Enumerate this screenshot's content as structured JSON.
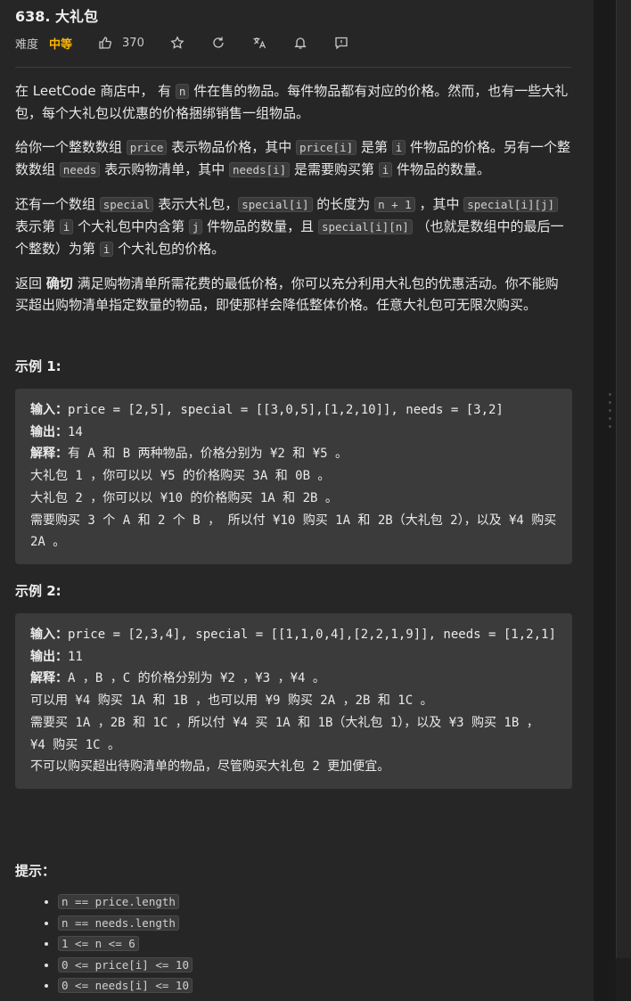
{
  "problem": {
    "title": "638. 大礼包",
    "difficulty_label": "难度",
    "difficulty": "中等",
    "likes": "370"
  },
  "description": {
    "p1": {
      "a": "在 LeetCode 商店中， 有 ",
      "c1": "n",
      "b": " 件在售的物品。每件物品都有对应的价格。然而，也有一些大礼包，每个大礼包以优惠的价格捆绑销售一组物品。"
    },
    "p2": {
      "a": "给你一个整数数组 ",
      "c1": "price",
      "b": " 表示物品价格，其中 ",
      "c2": "price[i]",
      "c": " 是第 ",
      "c3": "i",
      "d": " 件物品的价格。另有一个整数数组 ",
      "c4": "needs",
      "e": " 表示购物清单，其中 ",
      "c5": "needs[i]",
      "f": " 是需要购买第 ",
      "c6": "i",
      "g": " 件物品的数量。"
    },
    "p3": {
      "a": "还有一个数组 ",
      "c1": "special",
      "b": " 表示大礼包，",
      "c2": "special[i]",
      "c": " 的长度为 ",
      "c3": "n + 1",
      "d": " ，其中 ",
      "c4": "special[i][j]",
      "e": " 表示第 ",
      "c5": "i",
      "f": " 个大礼包中内含第 ",
      "c6": "j",
      "g": " 件物品的数量，且 ",
      "c7": "special[i][n]",
      "h": " （也就是数组中的最后一个整数）为第 ",
      "c8": "i",
      "i": " 个大礼包的价格。"
    },
    "p4": {
      "a": "返回 ",
      "bold": "确切",
      "b": " 满足购物清单所需花费的最低价格，你可以充分利用大礼包的优惠活动。你不能购买超出购物清单指定数量的物品，即使那样会降低整体价格。任意大礼包可无限次购买。"
    }
  },
  "examples": [
    {
      "heading": "示例 1:",
      "input_label": "输入：",
      "input": "price = [2,5], special = [[3,0,5],[1,2,10]], needs = [3,2]",
      "output_label": "输出：",
      "output": "14",
      "explain_label": "解释：",
      "explain_lines": [
        "有 A 和 B 两种物品，价格分别为 ¥2 和 ¥5 。",
        "大礼包 1 ，你可以以 ¥5 的价格购买 3A 和 0B 。",
        "大礼包 2 ，你可以以 ¥10 的价格购买 1A 和 2B 。",
        "需要购买 3 个 A 和 2 个 B ， 所以付 ¥10 购买 1A 和 2B（大礼包 2），以及 ¥4 购买 2A 。"
      ]
    },
    {
      "heading": "示例 2:",
      "input_label": "输入：",
      "input": "price = [2,3,4], special = [[1,1,0,4],[2,2,1,9]], needs = [1,2,1]",
      "output_label": "输出：",
      "output": "11",
      "explain_label": "解释：",
      "explain_lines": [
        "A ，B ，C 的价格分别为 ¥2 ，¥3 ，¥4 。",
        "可以用 ¥4 购买 1A 和 1B ，也可以用 ¥9 购买 2A ，2B 和 1C 。",
        "需要买 1A ，2B 和 1C ，所以付 ¥4 买 1A 和 1B（大礼包 1），以及 ¥3 购买 1B ， ¥4 购买 1C 。",
        "不可以购买超出待购清单的物品，尽管购买大礼包 2 更加便宜。"
      ]
    }
  ],
  "hints": {
    "heading": "提示：",
    "items": [
      "n == price.length",
      "n == needs.length",
      "1 <= n <= 6",
      "0 <= price[i] <= 10",
      "0 <= needs[i] <= 10"
    ]
  },
  "icons": [
    "thumbs-up-icon",
    "star-icon",
    "refresh-icon",
    "translate-icon",
    "bell-icon",
    "feedback-icon"
  ]
}
